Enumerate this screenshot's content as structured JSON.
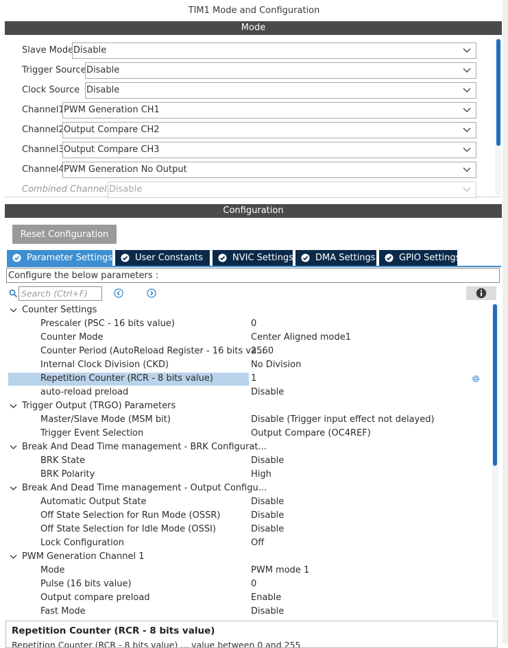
{
  "window": {
    "title": "TIM1 Mode and Configuration"
  },
  "mode": {
    "header": "Mode",
    "rows": [
      {
        "label": "Slave Mode",
        "value": "Disable"
      },
      {
        "label": "Trigger Source",
        "value": "Disable"
      },
      {
        "label": "Clock Source",
        "value": "Disable"
      },
      {
        "label": "Channel1",
        "value": "PWM Generation CH1"
      },
      {
        "label": "Channel2",
        "value": "Output Compare CH2"
      },
      {
        "label": "Channel3",
        "value": "Output Compare CH3"
      },
      {
        "label": "Channel4",
        "value": "PWM Generation No Output"
      },
      {
        "label": "Combined Channels",
        "value": "Disable"
      }
    ]
  },
  "configuration": {
    "header": "Configuration",
    "reset_label": "Reset Configuration",
    "tabs": [
      {
        "label": "Parameter Settings",
        "active": true
      },
      {
        "label": "User Constants",
        "active": false
      },
      {
        "label": "NVIC Settings",
        "active": false
      },
      {
        "label": "DMA Settings",
        "active": false
      },
      {
        "label": "GPIO Settings",
        "active": false
      }
    ],
    "instruction": "Configure the below parameters :",
    "search_placeholder": "Search (Ctrl+F)"
  },
  "tree": {
    "groups": [
      {
        "label": "Counter Settings"
      },
      {
        "label": "Trigger Output (TRGO) Parameters"
      },
      {
        "label": "Break And Dead Time management - BRK Configurat..."
      },
      {
        "label": "Break And Dead Time management - Output Configu..."
      },
      {
        "label": "PWM Generation Channel 1"
      }
    ],
    "params": [
      {
        "name": "Prescaler (PSC - 16 bits value)",
        "value": "0"
      },
      {
        "name": "Counter Mode",
        "value": "Center Aligned mode1"
      },
      {
        "name": "Counter Period (AutoReload Register - 16 bits va...",
        "value": "2560"
      },
      {
        "name": "Internal Clock Division (CKD)",
        "value": "No Division"
      },
      {
        "name": "Repetition Counter (RCR - 8 bits value)",
        "value": "1"
      },
      {
        "name": "auto-reload preload",
        "value": "Disable"
      },
      {
        "name": "Master/Slave Mode (MSM bit)",
        "value": "Disable (Trigger input effect not delayed)"
      },
      {
        "name": "Trigger Event Selection",
        "value": "Output Compare (OC4REF)"
      },
      {
        "name": "BRK State",
        "value": "Disable"
      },
      {
        "name": "BRK Polarity",
        "value": "High"
      },
      {
        "name": "Automatic Output State",
        "value": "Disable"
      },
      {
        "name": "Off State Selection for Run Mode (OSSR)",
        "value": "Disable"
      },
      {
        "name": "Off State Selection for Idle Mode (OSSI)",
        "value": "Disable"
      },
      {
        "name": "Lock Configuration",
        "value": "Off"
      },
      {
        "name": "Mode",
        "value": "PWM mode 1"
      },
      {
        "name": "Pulse (16 bits value)",
        "value": "0"
      },
      {
        "name": "Output compare preload",
        "value": "Enable"
      },
      {
        "name": "Fast Mode",
        "value": "Disable"
      }
    ]
  },
  "description": {
    "title": "Repetition Counter (RCR - 8 bits value)",
    "text": "Repetition Counter (RCR - 8 bits value) ... value between 0 and 255"
  },
  "colors": {
    "header_bar": "#4a4a4a",
    "tab_active": "#3d8fd1",
    "tab_inactive": "#0b2a4a",
    "selection": "#b9d3ea",
    "scrollbar": "#1e6fbf"
  }
}
